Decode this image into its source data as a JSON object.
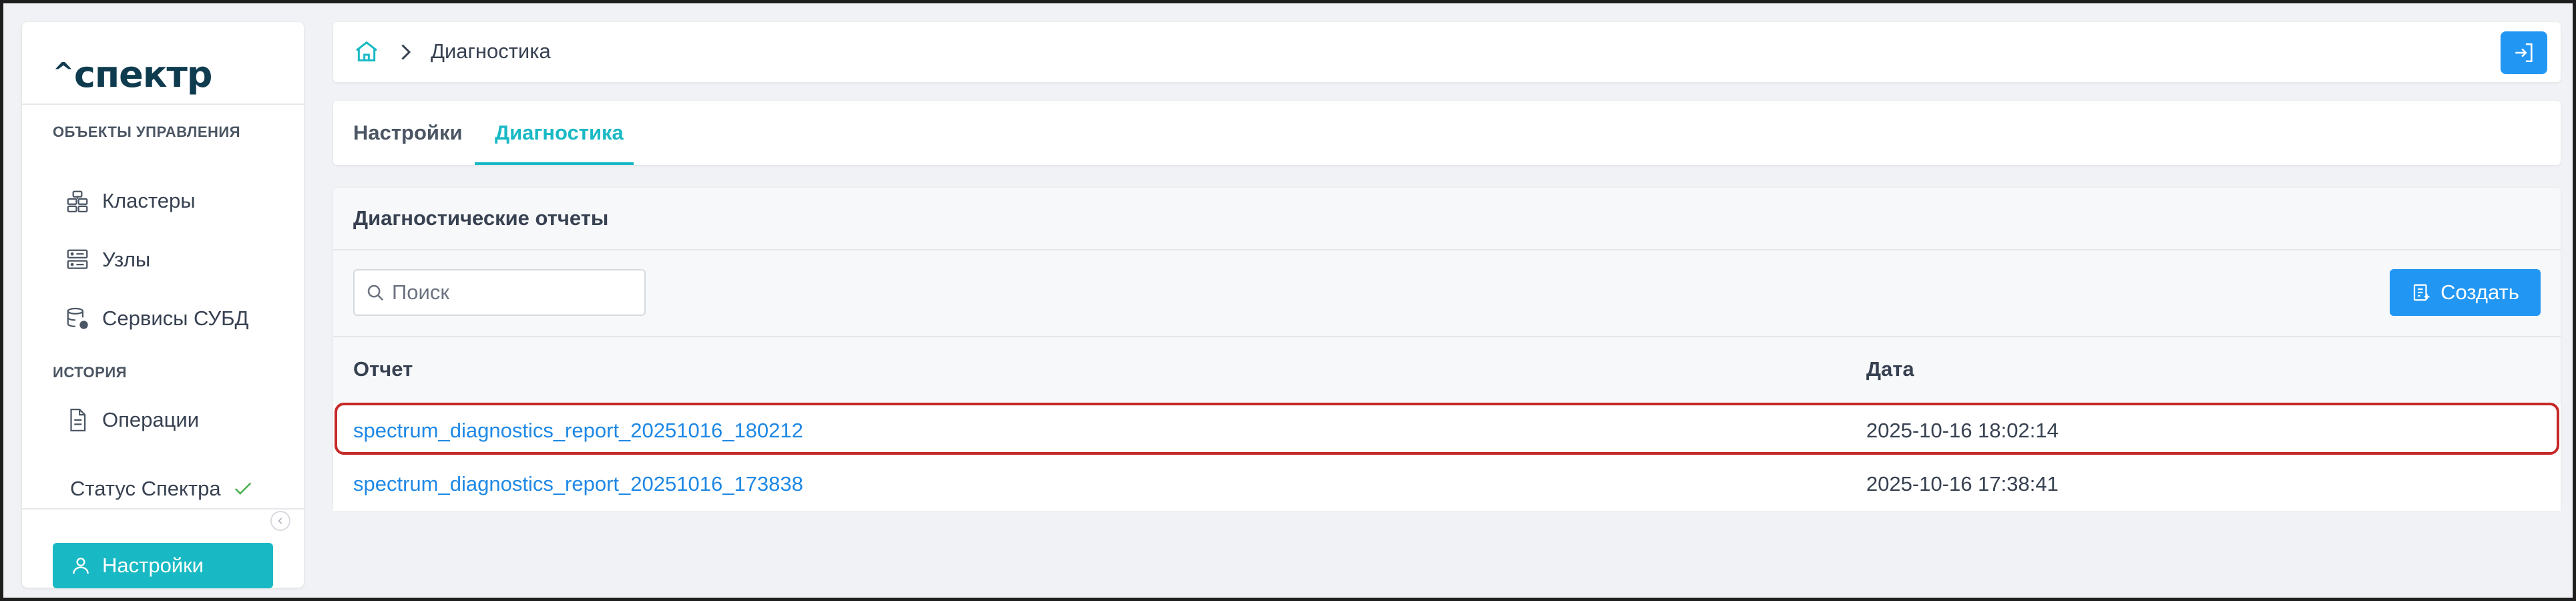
{
  "app": {
    "logo_caret": "^",
    "logo_word": "спектр"
  },
  "sidebar": {
    "section_objects": "ОБЪЕКТЫ УПРАВЛЕНИЯ",
    "section_history": "ИСТОРИЯ",
    "items": [
      {
        "label": "Кластеры",
        "icon": "cluster-icon"
      },
      {
        "label": "Узлы",
        "icon": "server-icon"
      },
      {
        "label": "Сервисы СУБД",
        "icon": "database-settings-icon"
      },
      {
        "label": "Операции",
        "icon": "document-icon"
      }
    ],
    "status_label": "Статус Спектра",
    "status_icon": "check-icon",
    "settings_label": "Настройки"
  },
  "header": {
    "breadcrumb_current": "Диагностика",
    "home_icon": "home-icon",
    "logout_icon": "logout-icon"
  },
  "tabs": [
    {
      "label": "Настройки",
      "active": false
    },
    {
      "label": "Диагностика",
      "active": true
    }
  ],
  "panel": {
    "title": "Диагностические отчеты",
    "search_placeholder": "Поиск",
    "create_label": "Создать",
    "columns": [
      "Отчет",
      "Дата"
    ],
    "rows": [
      {
        "report": "spectrum_diagnostics_report_20251016_180212",
        "date": "2025-10-16 18:02:14",
        "highlighted": true
      },
      {
        "report": "spectrum_diagnostics_report_20251016_173838",
        "date": "2025-10-16 17:38:41",
        "highlighted": false
      }
    ]
  },
  "colors": {
    "accent_teal": "#18b9c4",
    "primary_blue": "#2196f3",
    "link_blue": "#1e88e5",
    "highlight_red": "#c62828",
    "status_green": "#4caf50"
  }
}
